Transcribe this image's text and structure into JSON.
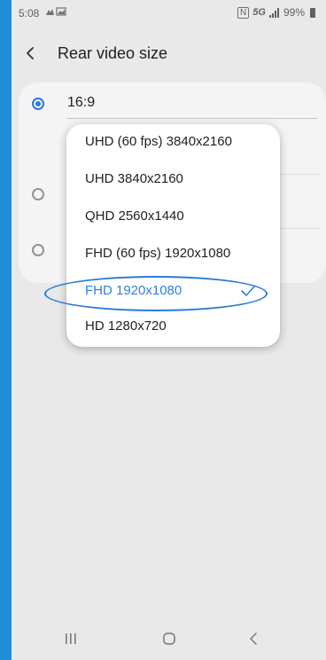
{
  "status_bar": {
    "time": "5:08",
    "network": "5G",
    "battery": "99%"
  },
  "header": {
    "title": "Rear video size"
  },
  "options": [
    {
      "label": "16:9",
      "selected": true
    },
    {
      "label": "",
      "selected": false
    },
    {
      "label": "",
      "selected": false
    }
  ],
  "dropdown": {
    "items": [
      {
        "label": "UHD (60 fps) 3840x2160"
      },
      {
        "label": "UHD 3840x2160"
      },
      {
        "label": "QHD 2560x1440"
      },
      {
        "label": "FHD (60 fps) 1920x1080"
      },
      {
        "label": "FHD 1920x1080",
        "selected": true
      },
      {
        "label": "HD 1280x720"
      }
    ]
  },
  "colors": {
    "accent": "#2f7fe0",
    "frame": "#1e8fd6",
    "annotation": "#2a79d6"
  },
  "icons": {
    "back": "chevron-left-icon",
    "check": "check-icon",
    "recents": "recents-icon",
    "home": "home-icon",
    "nav_back": "back-icon"
  }
}
